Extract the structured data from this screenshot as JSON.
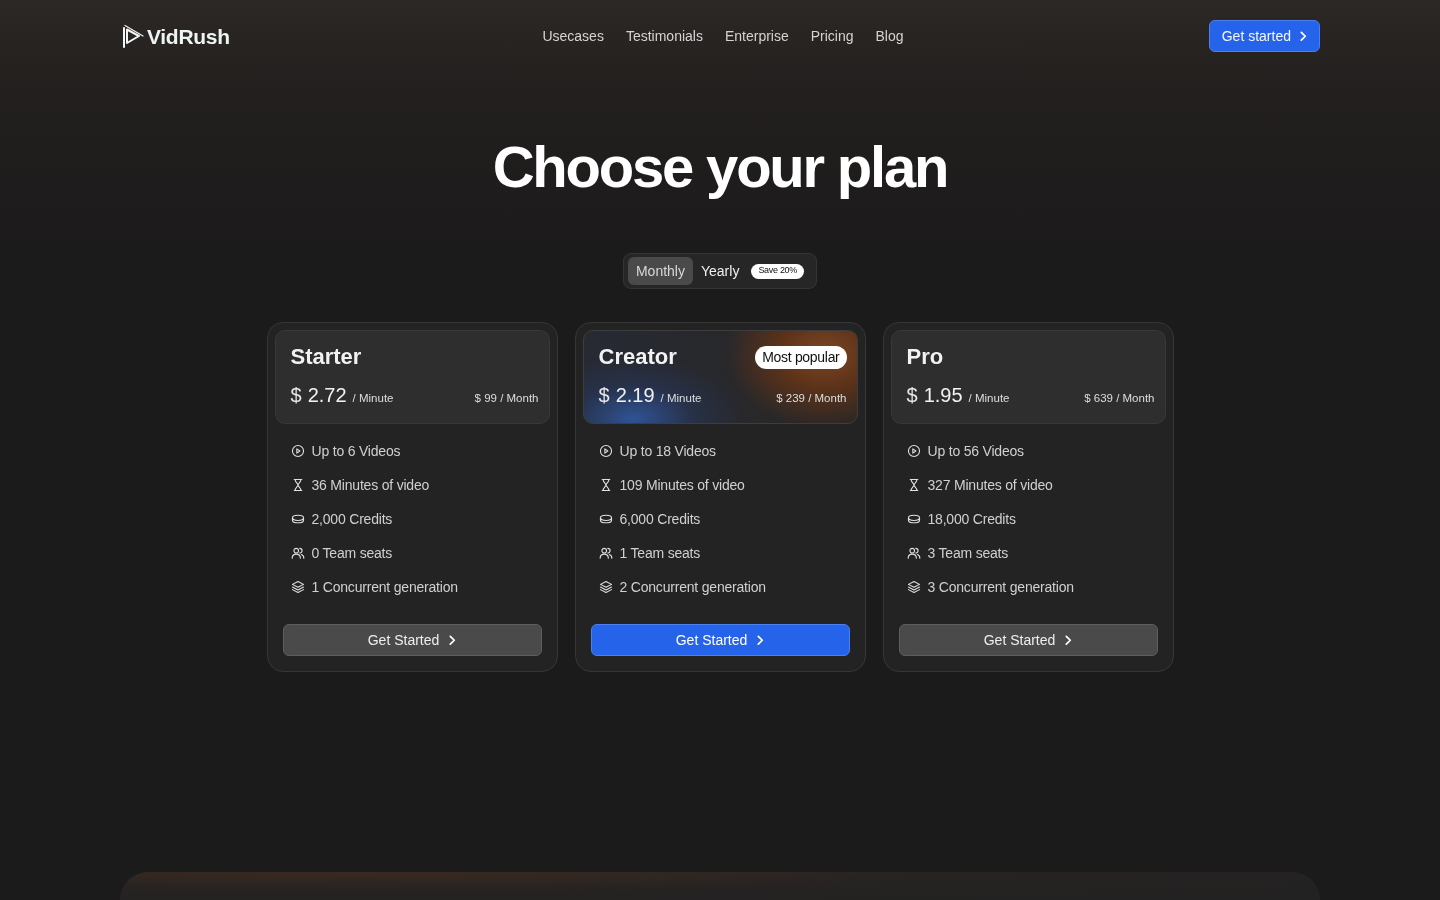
{
  "logo": {
    "text": "VidRush"
  },
  "nav": [
    {
      "label": "Usecases"
    },
    {
      "label": "Testimonials"
    },
    {
      "label": "Enterprise"
    },
    {
      "label": "Pricing"
    },
    {
      "label": "Blog"
    }
  ],
  "header_button": {
    "label": "Get started"
  },
  "title": "Choose your plan",
  "billing_toggle": {
    "options": [
      {
        "label": "Monthly",
        "selected": true
      },
      {
        "label": "Yearly",
        "selected": false
      }
    ],
    "badge": "Save 20%"
  },
  "plans": [
    {
      "name": "Starter",
      "highlighted": false,
      "currency": "$",
      "price": "2.72",
      "unit": "/ Minute",
      "monthly_price": "$ 99 / Month",
      "features": [
        {
          "kind": "videos",
          "text": "Up to 6 Videos"
        },
        {
          "kind": "minutes",
          "text": "36 Minutes of video"
        },
        {
          "kind": "credits",
          "text": "2,000 Credits"
        },
        {
          "kind": "seats",
          "text": "0 Team seats"
        },
        {
          "kind": "concurrency",
          "text": "1 Concurrent generation"
        }
      ],
      "button": "Get Started"
    },
    {
      "name": "Creator",
      "badge": "Most popular",
      "highlighted": true,
      "currency": "$",
      "price": "2.19",
      "unit": "/ Minute",
      "monthly_price": "$ 239 / Month",
      "features": [
        {
          "kind": "videos",
          "text": "Up to 18 Videos"
        },
        {
          "kind": "minutes",
          "text": "109 Minutes of video"
        },
        {
          "kind": "credits",
          "text": "6,000 Credits"
        },
        {
          "kind": "seats",
          "text": "1 Team seats"
        },
        {
          "kind": "concurrency",
          "text": "2 Concurrent generation"
        }
      ],
      "button": "Get Started"
    },
    {
      "name": "Pro",
      "highlighted": false,
      "currency": "$",
      "price": "1.95",
      "unit": "/ Minute",
      "monthly_price": "$ 639 / Month",
      "features": [
        {
          "kind": "videos",
          "text": "Up to 56 Videos"
        },
        {
          "kind": "minutes",
          "text": "327 Minutes of video"
        },
        {
          "kind": "credits",
          "text": "18,000 Credits"
        },
        {
          "kind": "seats",
          "text": "3 Team seats"
        },
        {
          "kind": "concurrency",
          "text": "3 Concurrent generation"
        }
      ],
      "button": "Get Started"
    }
  ]
}
